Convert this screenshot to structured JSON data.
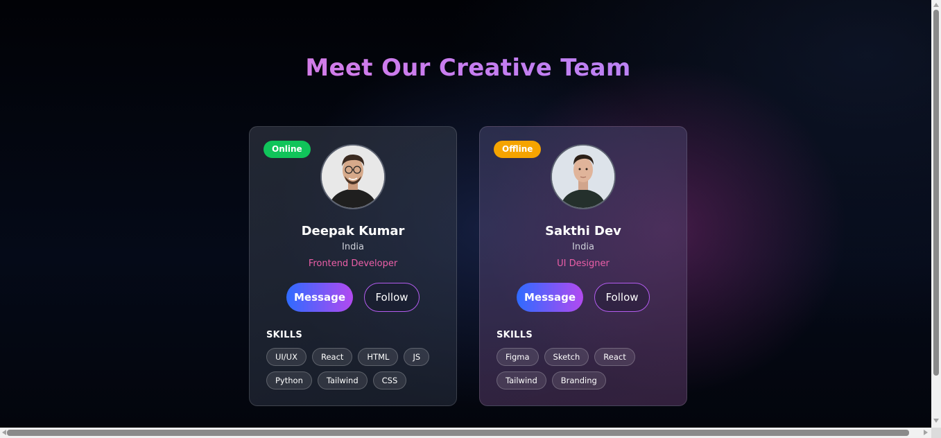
{
  "page": {
    "title": "Meet Our Creative Team"
  },
  "members": [
    {
      "status": "Online",
      "name": "Deepak Kumar",
      "country": "India",
      "role": "Frontend Developer",
      "message_label": "Message",
      "follow_label": "Follow",
      "skills_label": "SKILLS",
      "skills": [
        "UI/UX",
        "React",
        "HTML",
        "JS",
        "Python",
        "Tailwind",
        "CSS"
      ]
    },
    {
      "status": "Offline",
      "name": "Sakthi Dev",
      "country": "India",
      "role": "UI Designer",
      "message_label": "Message",
      "follow_label": "Follow",
      "skills_label": "SKILLS",
      "skills": [
        "Figma",
        "Sketch",
        "React",
        "Tailwind",
        "Branding"
      ]
    }
  ],
  "colors": {
    "online": "#10c45a",
    "offline": "#f5a400",
    "role": "#ec5fa8",
    "accent_start": "#2f6bff",
    "accent_end": "#b24af0"
  },
  "icons": [
    "avatar-photo",
    "scroll-arrow"
  ]
}
